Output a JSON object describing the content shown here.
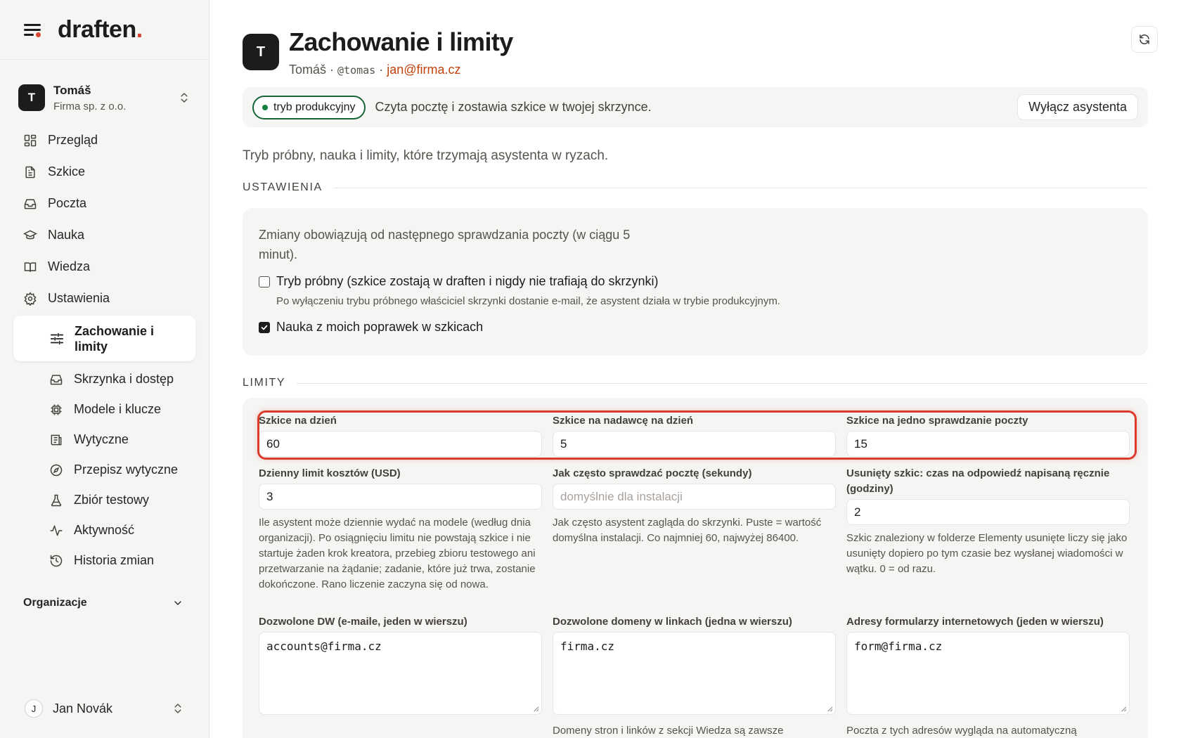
{
  "brand": {
    "name": "draften",
    "dot": "."
  },
  "account": {
    "initial": "T",
    "name": "Tomáš",
    "org": "Firma sp. z o.o."
  },
  "nav": {
    "items": [
      {
        "label": "Przegląd",
        "icon": "dashboard-icon"
      },
      {
        "label": "Szkice",
        "icon": "document-icon"
      },
      {
        "label": "Poczta",
        "icon": "inbox-icon"
      },
      {
        "label": "Nauka",
        "icon": "graduation-cap-icon"
      },
      {
        "label": "Wiedza",
        "icon": "book-icon"
      },
      {
        "label": "Ustawienia",
        "icon": "gear-icon"
      }
    ],
    "active_sub": {
      "label": "Zachowanie i limity",
      "icon": "sliders-icon"
    },
    "sub_items": [
      {
        "label": "Skrzynka i dostęp",
        "icon": "inbox-icon"
      },
      {
        "label": "Modele i klucze",
        "icon": "cpu-icon"
      },
      {
        "label": "Wytyczne",
        "icon": "guidelines-icon"
      },
      {
        "label": "Przepisz wytyczne",
        "icon": "compass-icon"
      },
      {
        "label": "Zbiór testowy",
        "icon": "flask-icon"
      },
      {
        "label": "Aktywność",
        "icon": "activity-icon"
      },
      {
        "label": "Historia zmian",
        "icon": "history-icon"
      }
    ],
    "org_section": "Organizacje"
  },
  "user": {
    "initial": "J",
    "name": "Jan Novák"
  },
  "header": {
    "initial": "T",
    "title": "Zachowanie i limity",
    "sub_name": "Tomáš",
    "sep1": " · ",
    "handle": "@tomas",
    "sep2": " · ",
    "email": "jan@firma.cz"
  },
  "status": {
    "badge": "tryb produkcyjny",
    "text": "Czyta pocztę i zostawia szkice w twojej skrzynce.",
    "button": "Wyłącz asystenta"
  },
  "intro": "Tryb próbny, nauka i limity, które trzymają asystenta w ryzach.",
  "settings": {
    "section": "USTAWIENIA",
    "note": "Zmiany obowiązują od następnego sprawdzania poczty (w ciągu 5 minut).",
    "trial": {
      "label": "Tryb próbny (szkice zostają w draften i nigdy nie trafiają do skrzynki)",
      "desc": "Po wyłączeniu trybu próbnego właściciel skrzynki dostanie e-mail, że asystent działa w trybie produkcyjnym.",
      "checked": false
    },
    "learn": {
      "label": "Nauka z moich poprawek w szkicach",
      "checked": true
    }
  },
  "limits": {
    "section": "LIMITY",
    "per_day": {
      "label": "Szkice na dzień",
      "value": "60"
    },
    "per_sender": {
      "label": "Szkice na nadawcę na dzień",
      "value": "5"
    },
    "per_check": {
      "label": "Szkice na jedno sprawdzanie poczty",
      "value": "15"
    },
    "cost": {
      "label": "Dzienny limit kosztów (USD)",
      "value": "3",
      "help": "Ile asystent może dziennie wydać na modele (według dnia organizacji). Po osiągnięciu limitu nie powstają szkice i nie startuje żaden krok kreatora, przebieg zbioru testowego ani przetwarzanie na żądanie; zadanie, które już trwa, zostanie dokończone. Rano liczenie zaczyna się od nowa."
    },
    "interval": {
      "label": "Jak często sprawdzać pocztę (sekundy)",
      "placeholder": "domyślnie dla instalacji",
      "help": "Jak często asystent zagląda do skrzynki. Puste = wartość domyślna instalacji. Co najmniej 60, najwyżej 86400."
    },
    "deleted": {
      "label": "Usunięty szkic: czas na odpowiedź napisaną ręcznie (godziny)",
      "value": "2",
      "help": "Szkic znaleziony w folderze Elementy usunięte liczy się jako usunięty dopiero po tym czasie bez wysłanej wiadomości w wątku. 0 = od razu."
    },
    "cc": {
      "label": "Dozwolone DW (e-maile, jeden w wierszu)",
      "value": "accounts@firma.cz"
    },
    "domains": {
      "label": "Dozwolone domeny w linkach (jedna w wierszu)",
      "value": "firma.cz",
      "help": "Domeny stron i linków z sekcji Wiedza są zawsze"
    },
    "forms": {
      "label": "Adresy formularzy internetowych (jeden w wierszu)",
      "value": "form@firma.cz",
      "help": "Poczta z tych adresów wygląda na automatyczną"
    }
  },
  "colors": {
    "accent": "#d9432f",
    "email": "#c2410c",
    "status_green": "#15803d",
    "highlight": "#dc3a2c"
  }
}
